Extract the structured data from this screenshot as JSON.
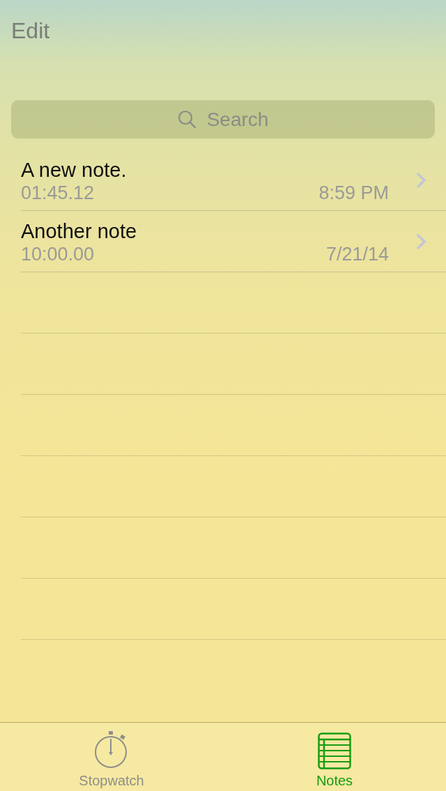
{
  "nav_bar": {
    "left_button": "Edit"
  },
  "search": {
    "placeholder": "Search"
  },
  "notes": [
    {
      "title": "A new note.",
      "time": "01:45.12",
      "date": "8:59 PM"
    },
    {
      "title": "Another note",
      "time": "10:00.00",
      "date": "7/21/14"
    }
  ],
  "tab_bar": [
    {
      "kind": "stopwatch",
      "label": "Stopwatch",
      "selected": false
    },
    {
      "kind": "notes",
      "label": "Notes",
      "selected": true
    }
  ]
}
